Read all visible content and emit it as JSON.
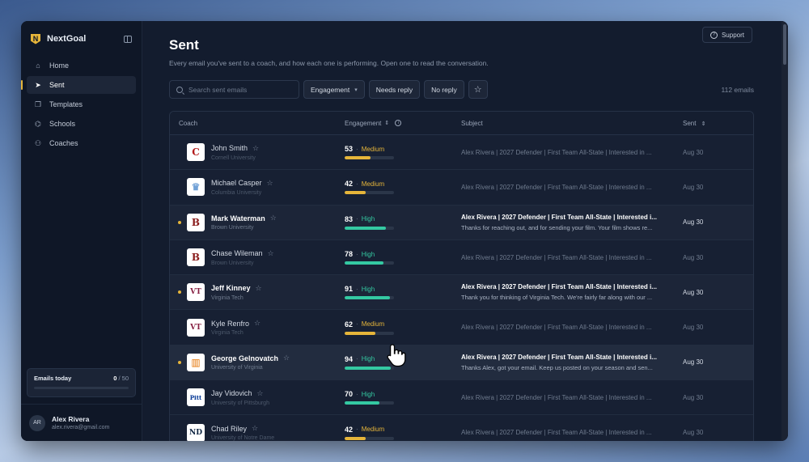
{
  "app": {
    "name": "NextGoal"
  },
  "sidebar": {
    "items": [
      {
        "label": "Home",
        "icon": "home-icon",
        "active": false
      },
      {
        "label": "Sent",
        "icon": "send-icon",
        "active": true
      },
      {
        "label": "Templates",
        "icon": "templates-icon",
        "active": false
      },
      {
        "label": "Schools",
        "icon": "schools-icon",
        "active": false
      },
      {
        "label": "Coaches",
        "icon": "coaches-icon",
        "active": false
      }
    ],
    "quota": {
      "label": "Emails today",
      "used": "0",
      "total": "50"
    },
    "user": {
      "initials": "AR",
      "name": "Alex Rivera",
      "email": "alex.rivera@gmail.com"
    }
  },
  "header": {
    "support_label": "Support",
    "title": "Sent",
    "subtitle": "Every email you've sent to a coach, and how each one is performing. Open one to read the conversation."
  },
  "toolbar": {
    "search_placeholder": "Search sent emails",
    "engagement_label": "Engagement",
    "needs_reply_label": "Needs reply",
    "no_reply_label": "No reply",
    "email_count": "112 emails"
  },
  "table": {
    "headers": {
      "coach": "Coach",
      "engagement": "Engagement",
      "subject": "Subject",
      "sent": "Sent"
    },
    "rows": [
      {
        "name": "John Smith",
        "school": "Cornell University",
        "logo": "C",
        "logo_color": "#b31b1b",
        "score": "53",
        "level": "Medium",
        "pct": 53,
        "subject": "Alex Rivera | 2027 Defender | First Team All-State | Interested in ...",
        "preview": "",
        "sent": "Aug 30",
        "unread": false
      },
      {
        "name": "Michael Casper",
        "school": "Columbia University",
        "logo": "♛",
        "logo_color": "#6fa0d6",
        "score": "42",
        "level": "Medium",
        "pct": 42,
        "subject": "Alex Rivera | 2027 Defender | First Team All-State | Interested in ...",
        "preview": "",
        "sent": "Aug 30",
        "unread": false
      },
      {
        "name": "Mark Waterman",
        "school": "Brown University",
        "logo": "B",
        "logo_color": "#8a1c1c",
        "score": "83",
        "level": "High",
        "pct": 83,
        "subject": "Alex Rivera | 2027 Defender | First Team All-State | Interested i...",
        "preview": "Thanks for reaching out, and for sending your film. Your film shows re...",
        "sent": "Aug 30",
        "unread": true
      },
      {
        "name": "Chase Wileman",
        "school": "Brown University",
        "logo": "B",
        "logo_color": "#8a1c1c",
        "score": "78",
        "level": "High",
        "pct": 78,
        "subject": "Alex Rivera | 2027 Defender | First Team All-State | Interested in ...",
        "preview": "",
        "sent": "Aug 30",
        "unread": false
      },
      {
        "name": "Jeff Kinney",
        "school": "Virginia Tech",
        "logo": "VT",
        "logo_color": "#861f41",
        "score": "91",
        "level": "High",
        "pct": 91,
        "subject": "Alex Rivera | 2027 Defender | First Team All-State | Interested i...",
        "preview": "Thank you for thinking of Virginia Tech. We're fairly far along with our ...",
        "sent": "Aug 30",
        "unread": true
      },
      {
        "name": "Kyle Renfro",
        "school": "Virginia Tech",
        "logo": "VT",
        "logo_color": "#861f41",
        "score": "62",
        "level": "Medium",
        "pct": 62,
        "subject": "Alex Rivera | 2027 Defender | First Team All-State | Interested in ...",
        "preview": "",
        "sent": "Aug 30",
        "unread": false
      },
      {
        "name": "George Gelnovatch",
        "school": "University of Virginia",
        "logo": "▥",
        "logo_color": "#e57200",
        "score": "94",
        "level": "High",
        "pct": 94,
        "subject": "Alex Rivera | 2027 Defender | First Team All-State | Interested i...",
        "preview": "Thanks Alex, got your email. Keep us posted on your season and sen...",
        "sent": "Aug 30",
        "unread": true
      },
      {
        "name": "Jay Vidovich",
        "school": "University of Pittsburgh",
        "logo": "Pitt",
        "logo_color": "#003594",
        "score": "70",
        "level": "High",
        "pct": 70,
        "subject": "Alex Rivera | 2027 Defender | First Team All-State | Interested in ...",
        "preview": "",
        "sent": "Aug 30",
        "unread": false
      },
      {
        "name": "Chad Riley",
        "school": "University of Notre Dame",
        "logo": "ND",
        "logo_color": "#0c2340",
        "score": "42",
        "level": "Medium",
        "pct": 42,
        "subject": "Alex Rivera | 2027 Defender | First Team All-State | Interested in ...",
        "preview": "",
        "sent": "Aug 30",
        "unread": false
      }
    ]
  },
  "colors": {
    "accent": "#e6b53a",
    "medium": "#e6b53a",
    "high": "#34c9a2"
  }
}
